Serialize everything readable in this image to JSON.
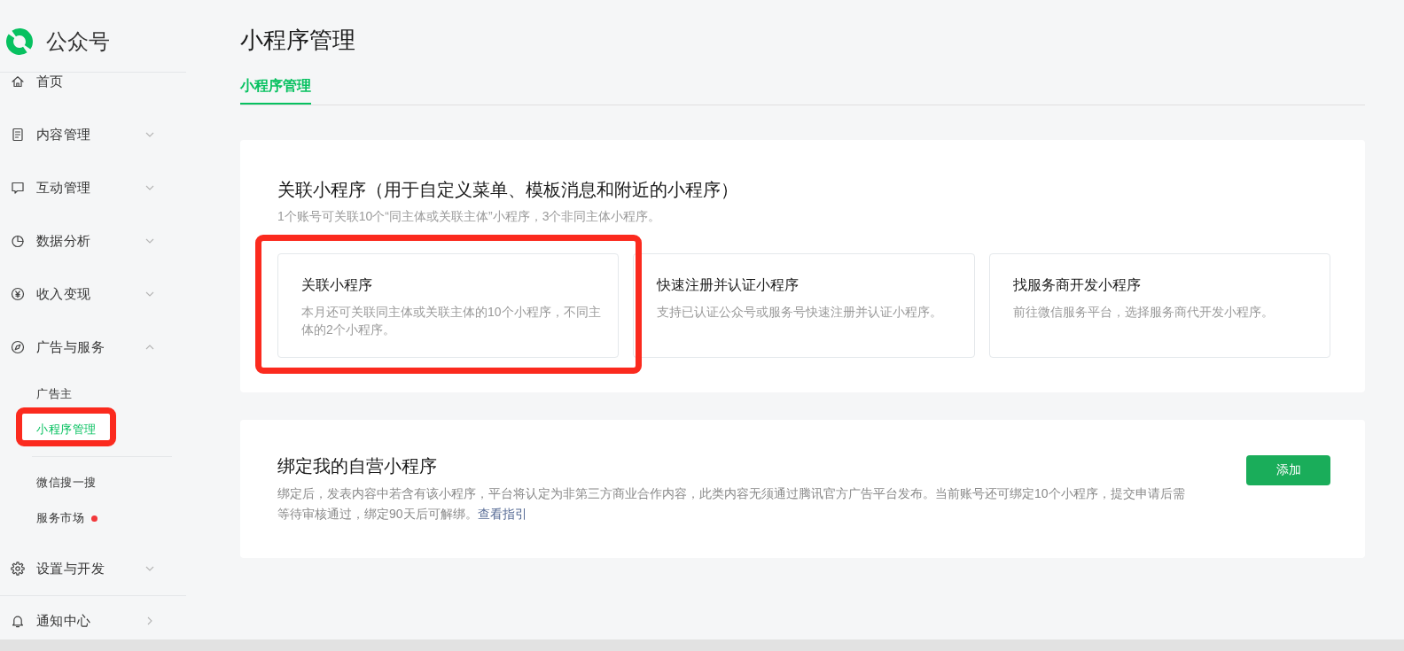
{
  "brand": {
    "name": "公众号"
  },
  "sidebar": {
    "items": [
      {
        "kind": "plain",
        "label": "首页",
        "divider_before": false
      },
      {
        "kind": "group",
        "label": "内容管理",
        "expanded": false,
        "divider_before": false
      },
      {
        "kind": "group",
        "label": "互动管理",
        "expanded": false,
        "divider_before": false
      },
      {
        "kind": "group",
        "label": "数据分析",
        "expanded": false,
        "divider_before": false
      },
      {
        "kind": "group",
        "label": "收入变现",
        "expanded": false,
        "divider_before": false
      },
      {
        "kind": "group",
        "label": "广告与服务",
        "expanded": true,
        "divider_before": false,
        "children": [
          {
            "label": "广告主",
            "selected": false,
            "highlighted": false,
            "notice": false,
            "divider_before": false
          },
          {
            "label": "小程序管理",
            "selected": true,
            "highlighted": true,
            "notice": false,
            "divider_before": false
          },
          {
            "label": "微信搜一搜",
            "selected": false,
            "highlighted": false,
            "notice": false,
            "divider_before": true
          },
          {
            "label": "服务市场",
            "selected": false,
            "highlighted": false,
            "notice": true,
            "divider_before": false
          }
        ]
      },
      {
        "kind": "group",
        "label": "设置与开发",
        "expanded": false,
        "divider_before": false
      },
      {
        "kind": "drill",
        "label": "通知中心",
        "divider_before": true
      }
    ]
  },
  "page": {
    "title": "小程序管理",
    "tabs": [
      {
        "label": "小程序管理",
        "selected": true
      }
    ],
    "sections": [
      {
        "kind": "options",
        "title": "关联小程序（用于自定义菜单、模板消息和附近的小程序）",
        "description": "1个账号可关联10个“同主体或关联主体”小程序，3个非同主体小程序。",
        "options": [
          {
            "title": "关联小程序",
            "description": "本月还可关联同主体或关联主体的10个小程序，不同主体的2个小程序。",
            "highlighted": true
          },
          {
            "title": "快速注册并认证小程序",
            "description": "支持已认证公众号或服务号快速注册并认证小程序。",
            "highlighted": false
          },
          {
            "title": "找服务商开发小程序",
            "description": "前往微信服务平台，选择服务商代开发小程序。",
            "highlighted": false
          }
        ]
      },
      {
        "kind": "action",
        "title": "绑定我的自营小程序",
        "description": "绑定后，发表内容中若含有该小程序，平台将认定为非第三方商业合作内容，此类内容无须通过腾讯官方广告平台发布。当前账号还可绑定10个小程序，提交申请后需等待审核通过，绑定90天后可解绑。",
        "link": "查看指引",
        "button": "添加"
      }
    ]
  }
}
